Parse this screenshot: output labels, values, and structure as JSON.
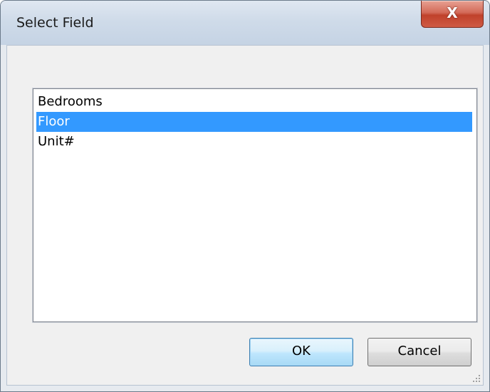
{
  "window": {
    "title": "Select Field",
    "close_label": "X"
  },
  "list": {
    "items": [
      "Bedrooms",
      "Floor",
      "Unit#"
    ],
    "selected": "Floor"
  },
  "buttons": {
    "ok_label": "OK",
    "cancel_label": "Cancel"
  },
  "colors": {
    "selection": "#3399ff",
    "close_button": "#c9503c"
  }
}
